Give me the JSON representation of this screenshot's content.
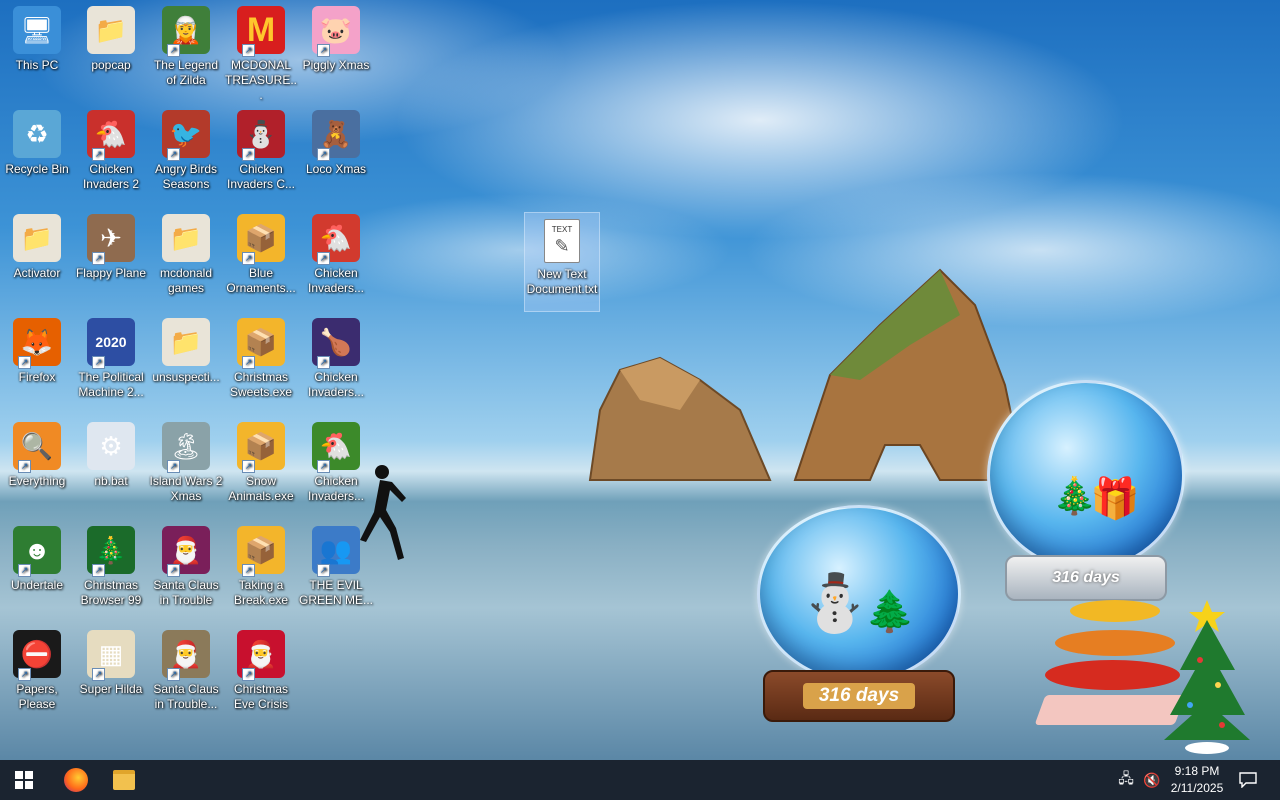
{
  "desktop": {
    "icons": [
      {
        "label": "This PC",
        "icon": "computer-icon",
        "glyph": "🖥",
        "bg": "#3a8fd8",
        "shortcut": false
      },
      {
        "label": "popcap",
        "icon": "folder-icon",
        "glyph": "📁",
        "bg": "#e9e4d8",
        "shortcut": false
      },
      {
        "label": "The Legend of Zilda",
        "icon": "zilda-game-icon",
        "glyph": "🧝",
        "bg": "#3f7f3a",
        "shortcut": true
      },
      {
        "label": "MCDONAL TREASURE...",
        "icon": "mcdonalds-icon",
        "glyph": "M",
        "bg": "#d81e1e",
        "shortcut": true
      },
      {
        "label": "Piggly Xmas",
        "icon": "pig-icon",
        "glyph": "🐷",
        "bg": "#f4a2c9",
        "shortcut": true
      },
      {
        "label": "Recycle Bin",
        "icon": "recycle-bin-icon",
        "glyph": "♻",
        "bg": "#5aa7d6",
        "shortcut": false
      },
      {
        "label": "Chicken Invaders 2",
        "icon": "chicken-invaders-icon",
        "glyph": "🐔",
        "bg": "#c9302c",
        "shortcut": true
      },
      {
        "label": "Angry Birds Seasons",
        "icon": "angry-birds-icon",
        "glyph": "🐦",
        "bg": "#b33a2a",
        "shortcut": true
      },
      {
        "label": "Chicken Invaders C...",
        "icon": "chicken-invaders-snowman-icon",
        "glyph": "⛄",
        "bg": "#b1202a",
        "shortcut": true
      },
      {
        "label": "Loco Xmas",
        "icon": "bear-icon",
        "glyph": "🧸",
        "bg": "#4a6fa0",
        "shortcut": true
      },
      {
        "label": "Activator",
        "icon": "folder-icon",
        "glyph": "📁",
        "bg": "#e9e4d8",
        "shortcut": false
      },
      {
        "label": "Flappy Plane",
        "icon": "flappy-plane-icon",
        "glyph": "✈",
        "bg": "#8f6b4f",
        "shortcut": true
      },
      {
        "label": "mcdonald games",
        "icon": "folder-icon",
        "glyph": "📁",
        "bg": "#e9e4d8",
        "shortcut": false
      },
      {
        "label": "Blue Ornaments...",
        "icon": "installer-icon",
        "glyph": "📦",
        "bg": "#f3b52b",
        "shortcut": true
      },
      {
        "label": "Chicken Invaders...",
        "icon": "chicken-invaders-icon",
        "glyph": "🐔",
        "bg": "#d23a2e",
        "shortcut": true
      },
      {
        "label": "Firefox",
        "icon": "firefox-icon",
        "glyph": "🦊",
        "bg": "#e66000",
        "shortcut": true
      },
      {
        "label": "The Political Machine 2...",
        "icon": "political-machine-icon",
        "glyph": "2020",
        "bg": "#2d4ea3",
        "shortcut": true
      },
      {
        "label": "unsuspecti...",
        "icon": "folder-icon",
        "glyph": "📁",
        "bg": "#e9e4d8",
        "shortcut": false
      },
      {
        "label": "Christmas Sweets.exe",
        "icon": "installer-icon",
        "glyph": "📦",
        "bg": "#f3b52b",
        "shortcut": true
      },
      {
        "label": "Chicken Invaders...",
        "icon": "chicken-invaders-icon",
        "glyph": "🍗",
        "bg": "#3b2c6f",
        "shortcut": true
      },
      {
        "label": "Everything",
        "icon": "search-magnifier-icon",
        "glyph": "🔍",
        "bg": "#f08a24",
        "shortcut": true
      },
      {
        "label": "nb.bat",
        "icon": "batch-file-icon",
        "glyph": "⚙",
        "bg": "#dfe7f0",
        "shortcut": false
      },
      {
        "label": "Island Wars 2 Xmas",
        "icon": "island-wars-icon",
        "glyph": "🏝",
        "bg": "#8aa2a8",
        "shortcut": true
      },
      {
        "label": "Snow Animals.exe",
        "icon": "installer-icon",
        "glyph": "📦",
        "bg": "#f3b52b",
        "shortcut": true
      },
      {
        "label": "Chicken Invaders...",
        "icon": "chicken-invaders-icon",
        "glyph": "🐔",
        "bg": "#3c8a2a",
        "shortcut": true
      },
      {
        "label": "Undertale",
        "icon": "undertale-icon",
        "glyph": "☻",
        "bg": "#2e7d32",
        "shortcut": true
      },
      {
        "label": "Christmas Browser 99",
        "icon": "christmas-tree-icon",
        "glyph": "🎄",
        "bg": "#1b6b2a",
        "shortcut": true
      },
      {
        "label": "Santa Claus in Trouble",
        "icon": "santa-icon",
        "glyph": "🎅",
        "bg": "#7a1f5a",
        "shortcut": true
      },
      {
        "label": "Taking a Break.exe",
        "icon": "installer-icon",
        "glyph": "📦",
        "bg": "#f3b52b",
        "shortcut": true
      },
      {
        "label": "THE EVIL GREEN ME...",
        "icon": "messenger-icon",
        "glyph": "👥",
        "bg": "#3c7bc8",
        "shortcut": true
      },
      {
        "label": "Papers, Please",
        "icon": "papers-please-icon",
        "glyph": "⛔",
        "bg": "#1a1a1a",
        "shortcut": true
      },
      {
        "label": "Super Hilda",
        "icon": "super-hilda-icon",
        "glyph": "▦",
        "bg": "#e6dcc0",
        "shortcut": true
      },
      {
        "label": "Santa Claus in Trouble...",
        "icon": "santa-icon",
        "glyph": "🎅",
        "bg": "#8b7a5a",
        "shortcut": true
      },
      {
        "label": "Christmas Eve Crisis",
        "icon": "santa-face-icon",
        "glyph": "🎅",
        "bg": "#c8102e",
        "shortcut": true
      }
    ],
    "selected_file": {
      "label": "New Text Document.txt",
      "icon": "text-file-icon",
      "badge": "TEXT"
    }
  },
  "widgets": {
    "globe_left": {
      "days_text": "316 days"
    },
    "globe_right": {
      "days_text": "316 days"
    }
  },
  "taskbar": {
    "clock_time": "9:18 PM",
    "clock_date": "2/11/2025",
    "colors": {
      "bg": "#1b2430",
      "accent": "#2b8fe0"
    }
  }
}
